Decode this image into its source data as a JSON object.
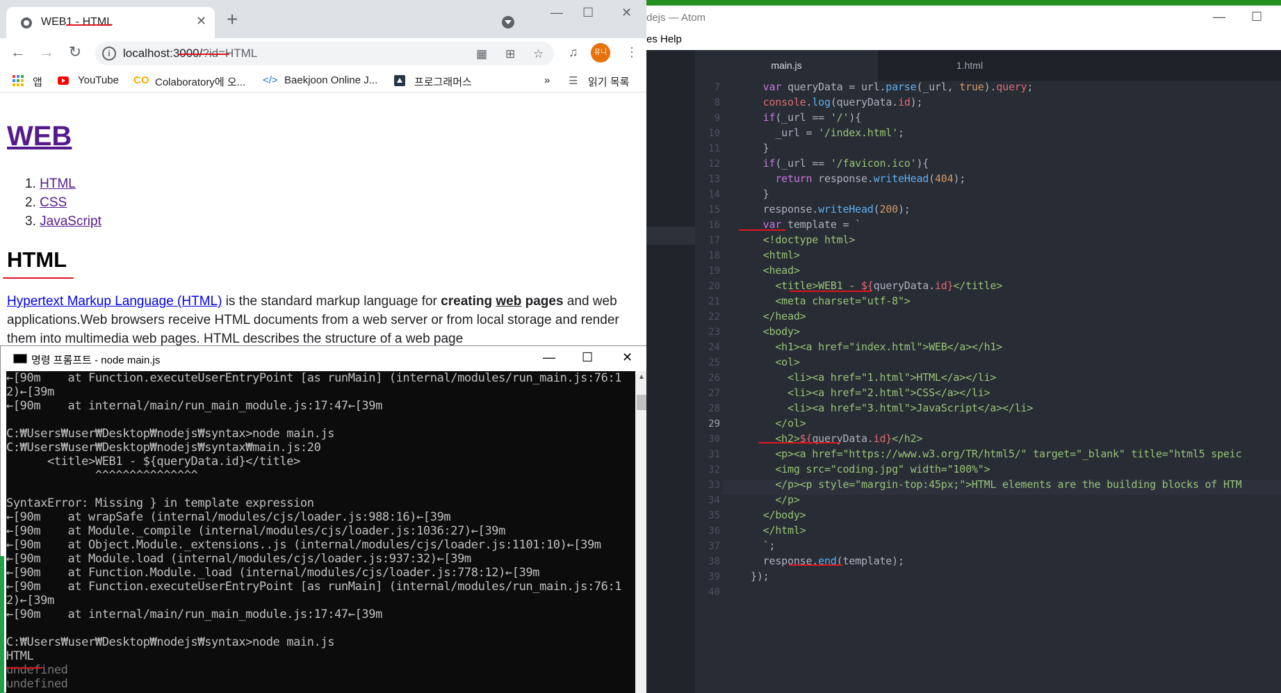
{
  "chrome": {
    "tab_title": "WEB1 - HTML",
    "new_tab": "+",
    "url_host": "localhost:3000/",
    "url_query": "?id=HTML",
    "avatar_label": "유니",
    "bookmarks": [
      "앱",
      "YouTube",
      "Colaboratory에 오...",
      "Baekjoon Online J...",
      "프로그래머스"
    ],
    "bookmarks_more": "»",
    "reading_list": "읽기 목록"
  },
  "page": {
    "heading": "WEB",
    "list": [
      {
        "num": "1.",
        "label": "HTML"
      },
      {
        "num": "2.",
        "label": "CSS"
      },
      {
        "num": "3.",
        "label": "JavaScript"
      }
    ],
    "subheading": "HTML",
    "para_link": "Hypertext Markup Language (HTML)",
    "para_1": " is the standard markup language for ",
    "para_bold1": "creating",
    "para_bold2": "web",
    "para_bold3": "pages",
    "para_2": " and web applications.Web browsers receive HTML documents from a web server or from local storage and render them into multimedia web pages. HTML describes the structure of a web page"
  },
  "cmd": {
    "title": "명령 프롬프트 - node  main.js",
    "lines": [
      "←[90m    at Function.executeUserEntryPoint [as runMain] (internal/modules/run_main.js:76:1",
      "2)←[39m",
      "←[90m    at internal/main/run_main_module.js:17:47←[39m",
      "",
      "C:₩Users₩user₩Desktop₩nodejs₩syntax>node main.js",
      "C:₩Users₩user₩Desktop₩nodejs₩syntax₩main.js:20",
      "      <title>WEB1 - ${queryData.id}</title>",
      "             ^^^^^^^^^^^^^^^",
      "",
      "SyntaxError: Missing } in template expression",
      "←[90m    at wrapSafe (internal/modules/cjs/loader.js:988:16)←[39m",
      "←[90m    at Module._compile (internal/modules/cjs/loader.js:1036:27)←[39m",
      "←[90m    at Object.Module._extensions..js (internal/modules/cjs/loader.js:1101:10)←[39m",
      "←[90m    at Module.load (internal/modules/cjs/loader.js:937:32)←[39m",
      "←[90m    at Function.Module._load (internal/modules/cjs/loader.js:778:12)←[39m",
      "←[90m    at Function.executeUserEntryPoint [as runMain] (internal/modules/run_main.js:76:1",
      "2)←[39m",
      "←[90m    at internal/main/run_main_module.js:17:47←[39m",
      "",
      "C:₩Users₩user₩Desktop₩nodejs₩syntax>node main.js",
      "HTML",
      "undefined",
      "undefined"
    ]
  },
  "atom": {
    "title": "dejs — Atom",
    "menu": "es   Help",
    "tabs": [
      "main.js",
      "1.html"
    ],
    "line_numbers": [
      "7",
      "8",
      "9",
      "10",
      "11",
      "12",
      "13",
      "14",
      "15",
      "16",
      "17",
      "18",
      "19",
      "20",
      "21",
      "22",
      "23",
      "24",
      "25",
      "26",
      "27",
      "28",
      "29",
      "30",
      "31",
      "32",
      "33",
      "34",
      "35",
      "36",
      "37",
      "38",
      "39",
      "40"
    ],
    "current_line": "29"
  },
  "colors": {
    "accent_red": "#e0141e",
    "atom_bg": "#282c34"
  }
}
